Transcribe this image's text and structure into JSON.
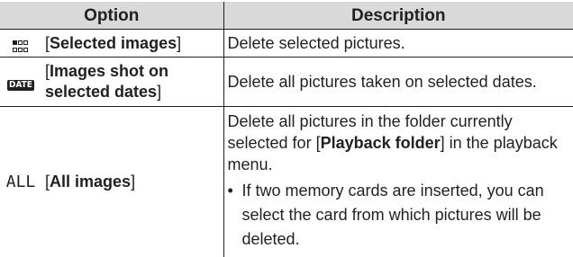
{
  "table": {
    "headers": {
      "option": "Option",
      "description": "Description"
    },
    "rows": [
      {
        "icon": "multi-thumbnail-icon",
        "icon_text": "",
        "option_open": "[",
        "option_label": "Selected images",
        "option_close": "]",
        "description": "Delete selected pictures."
      },
      {
        "icon": "date-icon",
        "icon_text": "DATE",
        "option_open": "[",
        "option_label": "Images shot on selected dates",
        "option_close": "]",
        "description": "Delete all pictures taken on selected dates."
      },
      {
        "icon": "all-icon",
        "icon_text": "ALL",
        "option_open": "[",
        "option_label": "All images",
        "option_close": "]",
        "description_pre": "Delete all pictures in the folder currently selected for [",
        "description_bold": "Playback folder",
        "description_post": "] in the playback menu.",
        "bullet_marker": "•",
        "bullet": "If two memory cards are inserted, you can select the card from which pictures will be deleted."
      }
    ]
  }
}
